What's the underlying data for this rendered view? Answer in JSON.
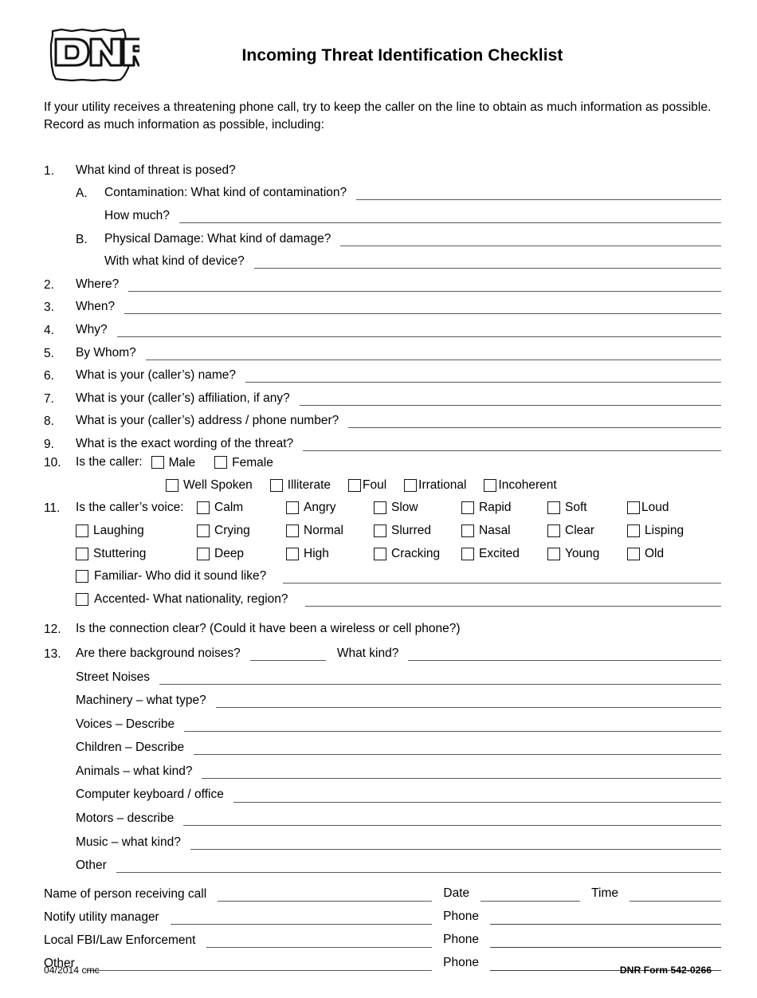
{
  "header": {
    "logo_alt": "Iowa DNR logo",
    "logo_text": "DNR",
    "title": "Incoming Threat Identification Checklist"
  },
  "intro": "If your utility receives a threatening phone call, try to keep the caller on the line to obtain as much information as possible. Record as much information as possible, including:",
  "questions": {
    "q1": {
      "num": "1.",
      "text": "What kind of threat is posed?",
      "sub_a": {
        "letter": "A.",
        "text": "Contamination: What kind of contamination?",
        "followup": "How much?"
      },
      "sub_b": {
        "letter": "B.",
        "text": "Physical Damage: What kind of damage?",
        "followup": "With what kind of device?"
      }
    },
    "q2": {
      "num": "2.",
      "text": "Where?"
    },
    "q3": {
      "num": "3.",
      "text": "When?"
    },
    "q4": {
      "num": "4.",
      "text": "Why?"
    },
    "q5": {
      "num": "5.",
      "text": "By Whom?"
    },
    "q6": {
      "num": "6.",
      "text": "What is your (caller’s) name?"
    },
    "q7": {
      "num": "7.",
      "text": "What is your (caller’s) affiliation, if any?"
    },
    "q8": {
      "num": "8.",
      "text": "What is your (caller’s) address / phone number?"
    },
    "q9": {
      "num": "9.",
      "text": "What is the exact wording of the threat?"
    },
    "q10": {
      "num": "10.",
      "text": "Is the caller:",
      "row1": [
        "Male",
        "Female"
      ],
      "row2": [
        "Well Spoken",
        "Illiterate",
        "Foul",
        "Irrational",
        "Incoherent"
      ]
    },
    "q11": {
      "num": "11.",
      "text": "Is the caller’s voice:",
      "row1": [
        "Calm",
        "Angry",
        "Slow",
        "Rapid",
        "Soft",
        "Loud"
      ],
      "row2": [
        "Laughing",
        "Crying",
        "Normal",
        "Slurred",
        "Nasal",
        "Clear",
        "Lisping"
      ],
      "row3": [
        "Stuttering",
        "Deep",
        "High",
        "Cracking",
        "Excited",
        "Young",
        "Old"
      ],
      "familiar": "Familiar- Who did it sound like?",
      "accented": "Accented- What nationality, region?"
    },
    "q12": {
      "num": "12.",
      "text": "Is the connection clear?  (Could it have been a wireless or cell phone?)"
    },
    "q13": {
      "num": "13.",
      "text": "Are there background noises?",
      "what_kind": "What kind?",
      "noises": [
        "Street Noises",
        "Machinery – what type?",
        "Voices – Describe",
        "Children – Describe",
        "Animals – what kind?",
        "Computer keyboard / office",
        "Motors – describe",
        "Music – what kind?",
        "Other"
      ]
    }
  },
  "contact": {
    "name_label": "Name of person receiving call",
    "date_label": "Date",
    "time_label": "Time",
    "rows": [
      {
        "label": "Notify utility manager",
        "mid": "Phone"
      },
      {
        "label": "Local FBI/Law Enforcement",
        "mid": "Phone"
      },
      {
        "label": "Other",
        "mid": "Phone"
      }
    ]
  },
  "footer": {
    "revision": "04/2014 cmc",
    "form_number": "DNR Form 542-0266"
  }
}
